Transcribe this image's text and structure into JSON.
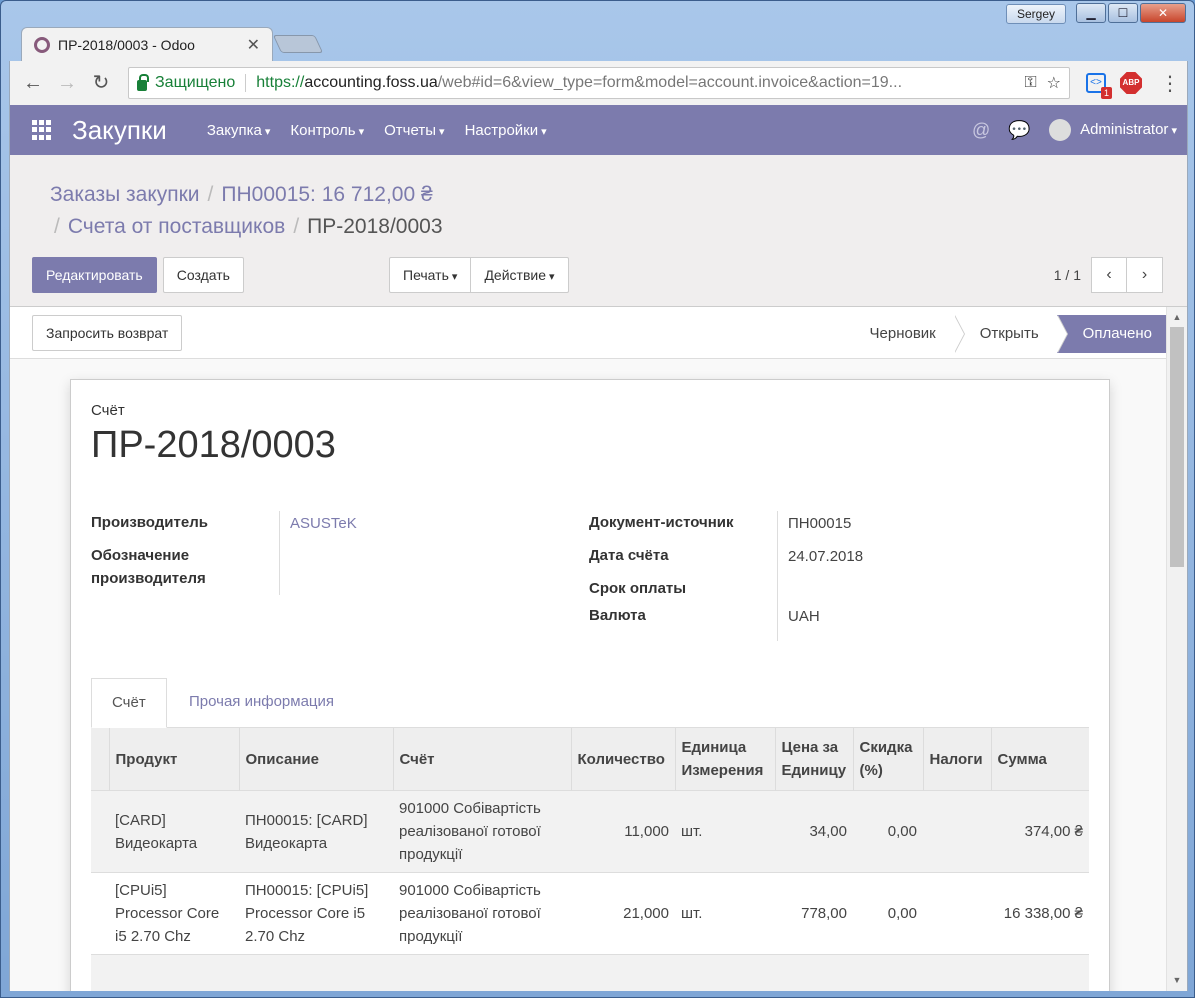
{
  "window": {
    "user": "Sergey",
    "minimize": "▁",
    "maximize": "☐",
    "close": "✕"
  },
  "browser": {
    "tab_title": "ПР-2018/0003 - Odoo",
    "tab_close": "✕",
    "back": "←",
    "forward": "→",
    "reload": "↻",
    "secure_label": "Защищено",
    "url_scheme": "https://",
    "url_host": "accounting.foss.ua",
    "url_rest": "/web#id=6&view_type=form&model=account.invoice&action=19...",
    "key_icon": "⚿",
    "star_icon": "☆",
    "ext_badge": "1",
    "ext_dev": "<>",
    "ext_abp": "ABP",
    "menu_icon": "⋮"
  },
  "topnav": {
    "app_title": "Закупки",
    "menus": [
      "Закупка",
      "Контроль",
      "Отчеты",
      "Настройки"
    ],
    "mention_icon": "@",
    "chat_icon": "💬",
    "user": "Administrator"
  },
  "breadcrumb": {
    "item1": "Заказы закупки",
    "item2": "ПН00015: 16 712,00 ₴",
    "item3": "Счета от поставщиков",
    "current": "ПР-2018/0003",
    "sep": "/"
  },
  "buttons": {
    "edit": "Редактировать",
    "create": "Создать",
    "print": "Печать",
    "action": "Действие",
    "refund": "Запросить возврат"
  },
  "pager": {
    "value": "1 / 1",
    "prev": "‹",
    "next": "›"
  },
  "stages": {
    "draft": "Черновик",
    "open": "Открыть",
    "paid": "Оплачено"
  },
  "form": {
    "doc_label": "Счёт",
    "doc_title": "ПР-2018/0003",
    "vendor_label": "Производитель",
    "vendor_value": "ASUSTeK",
    "vendor_ref_label": "Обозначение производителя",
    "source_label": "Документ-источник",
    "source_value": "ПН00015",
    "date_label": "Дата счёта",
    "date_value": "24.07.2018",
    "due_label": "Срок оплаты",
    "currency_label": "Валюта",
    "currency_value": "UAH"
  },
  "tabs": {
    "invoice": "Счёт",
    "other": "Прочая информация"
  },
  "table": {
    "headers": {
      "product": "Продукт",
      "description": "Описание",
      "account": "Счёт",
      "quantity": "Количество",
      "uom": "Единица Измерения",
      "price": "Цена за Единицу",
      "discount": "Скидка (%)",
      "taxes": "Налоги",
      "amount": "Сумма"
    },
    "rows": [
      {
        "product": "[CARD] Видеокарта",
        "description": "ПН00015: [CARD] Видеокарта",
        "account": "901000 Собівартість реалізованої готової продукції",
        "quantity": "11,000",
        "uom": "шт.",
        "price": "34,00",
        "discount": "0,00",
        "taxes": "",
        "amount": "374,00 ₴"
      },
      {
        "product": "[CPUi5] Processor Core i5 2.70 Chz",
        "description": "ПН00015: [CPUi5] Processor Core i5 2.70 Chz",
        "account": "901000 Собівартість реалізованої готової продукції",
        "quantity": "21,000",
        "uom": "шт.",
        "price": "778,00",
        "discount": "0,00",
        "taxes": "",
        "amount": "16 338,00 ₴"
      }
    ]
  },
  "colors": {
    "brand": "#7c7bad",
    "panel": "#f0eeee"
  }
}
